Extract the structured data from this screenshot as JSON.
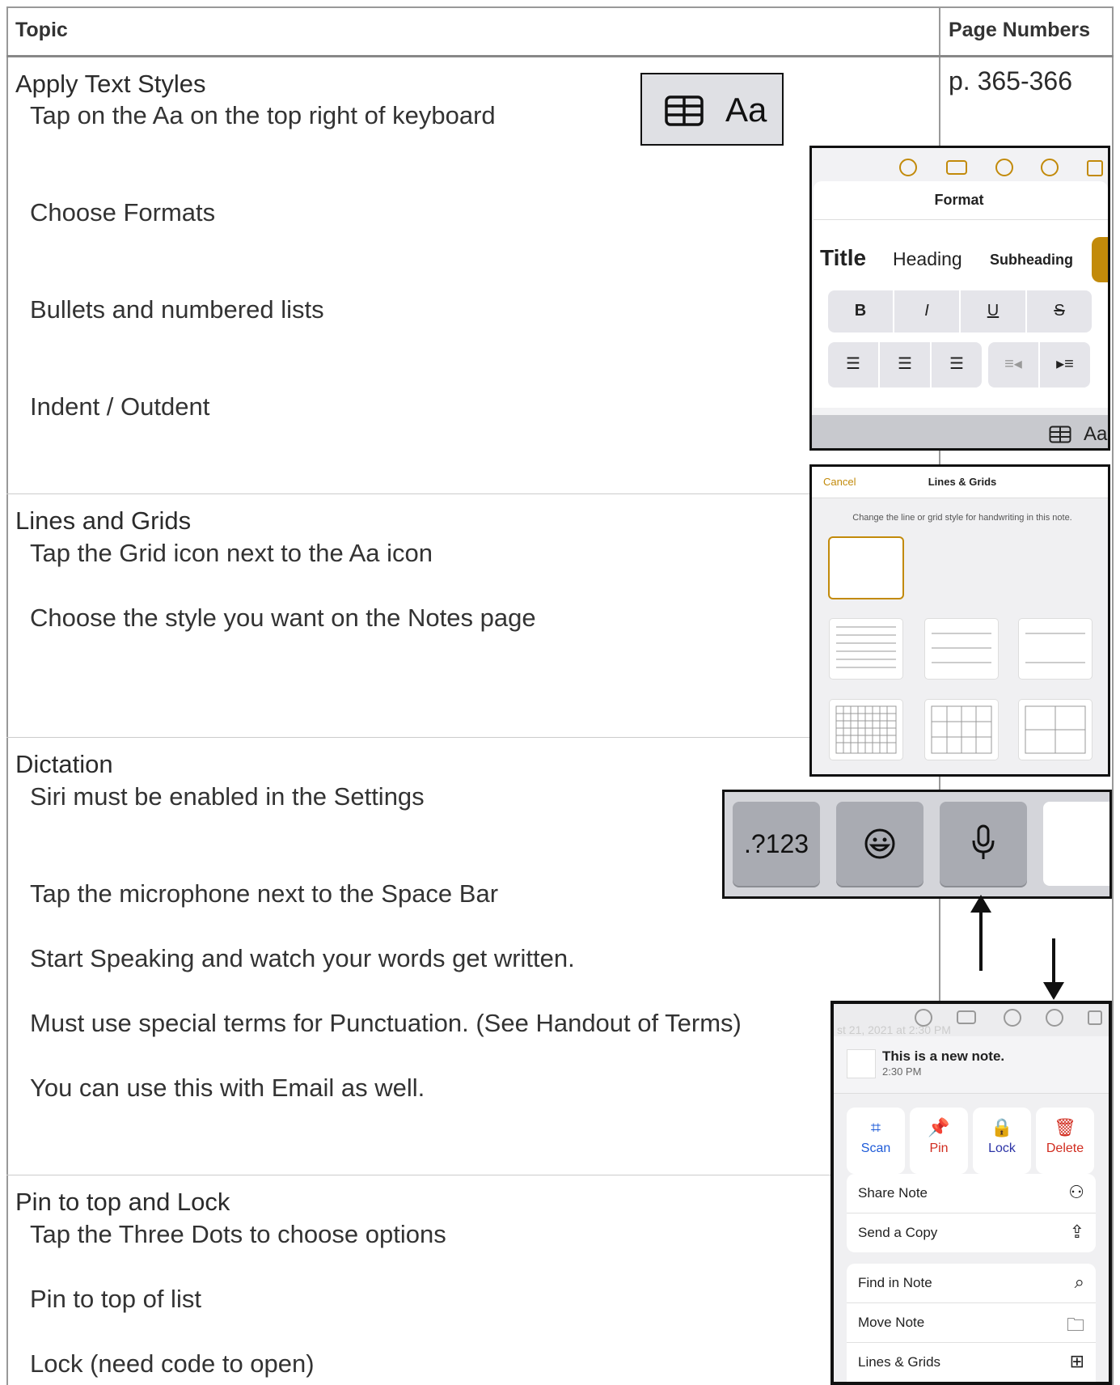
{
  "table": {
    "col_topic": "Topic",
    "col_pages": "Page Numbers"
  },
  "sections": [
    {
      "title": "Apply Text Styles",
      "pages": "p. 365-366",
      "items": [
        "Tap on the Aa on the top right of keyboard",
        "Choose Formats",
        "Bullets and numbered lists",
        "Indent / Outdent"
      ]
    },
    {
      "title": "Lines and Grids",
      "items": [
        "Tap the Grid icon next to the Aa icon",
        "Choose the style you want on the Notes page"
      ]
    },
    {
      "title": "Dictation",
      "items": [
        "Siri must be enabled in the Settings",
        "Tap the microphone next to the Space Bar",
        "Start Speaking and watch your words get written.",
        "Must use special terms for Punctuation. (See Handout of Terms)",
        "You can use this with Email as well."
      ]
    },
    {
      "title": "Pin to top and Lock",
      "items": [
        "Tap the Three Dots to choose options",
        "Pin to top of list",
        "Lock (need code to open)"
      ]
    }
  ],
  "aa_key": {
    "label": "Aa"
  },
  "format_panel": {
    "title": "Format",
    "styles": [
      "Title",
      "Heading",
      "Subheading"
    ],
    "bius": [
      "B",
      "I",
      "U",
      "S"
    ],
    "aa": "Aa"
  },
  "lines_grids": {
    "cancel": "Cancel",
    "title": "Lines & Grids",
    "desc": "Change the line or grid style for handwriting in this note."
  },
  "keyboard": {
    "numbers_key": ".?123"
  },
  "menu": {
    "date_faded": "st 21, 2021 at 2:30 PM",
    "note_title": "This is a new note.",
    "note_time": "2:30 PM",
    "buttons": [
      "Scan",
      "Pin",
      "Lock",
      "Delete"
    ],
    "rows": [
      "Share Note",
      "Send a Copy",
      "Find in Note",
      "Move Note",
      "Lines & Grids"
    ]
  },
  "colors": {
    "accent": "#c28a0a",
    "pin": "#d12c1f",
    "lock": "#2b33a6",
    "scan": "#1e5bd8"
  }
}
